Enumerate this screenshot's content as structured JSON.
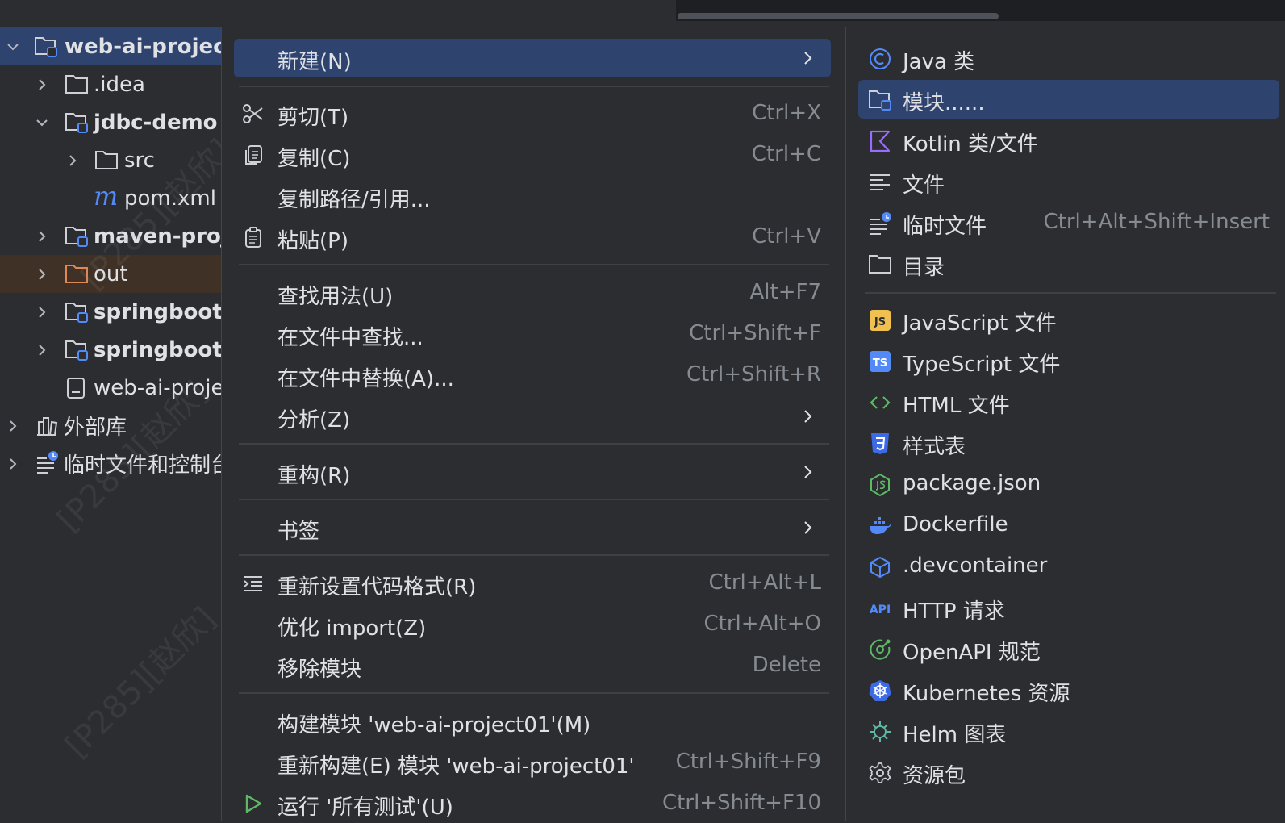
{
  "tree": {
    "items": [
      {
        "label": "web-ai-project",
        "icon": "module-folder-icon"
      },
      {
        "label": ".idea",
        "icon": "folder-icon"
      },
      {
        "label": "jdbc-demo",
        "icon": "module-folder-icon"
      },
      {
        "label": "src",
        "icon": "folder-icon"
      },
      {
        "label": "pom.xml",
        "icon": "maven-m-icon"
      },
      {
        "label": "maven-proj",
        "icon": "module-folder-icon"
      },
      {
        "label": "out",
        "icon": "excluded-folder-icon"
      },
      {
        "label": "springboot-",
        "icon": "module-folder-icon"
      },
      {
        "label": "springboot-",
        "icon": "module-folder-icon"
      },
      {
        "label": "web-ai-proje",
        "icon": "file-icon"
      },
      {
        "label": "外部库",
        "icon": "library-icon"
      },
      {
        "label": "临时文件和控制台",
        "icon": "scratch-icon"
      }
    ],
    "watermark": "[P285][赵欣]"
  },
  "menu": {
    "items": [
      {
        "label": "新建(N)",
        "shortcut": ""
      },
      {
        "label": "剪切(T)",
        "shortcut": "Ctrl+X"
      },
      {
        "label": "复制(C)",
        "shortcut": "Ctrl+C"
      },
      {
        "label": "复制路径/引用...",
        "shortcut": ""
      },
      {
        "label": "粘贴(P)",
        "shortcut": "Ctrl+V"
      },
      {
        "label": "查找用法(U)",
        "shortcut": "Alt+F7"
      },
      {
        "label": "在文件中查找...",
        "shortcut": "Ctrl+Shift+F"
      },
      {
        "label": "在文件中替换(A)...",
        "shortcut": "Ctrl+Shift+R"
      },
      {
        "label": "分析(Z)",
        "shortcut": ""
      },
      {
        "label": "重构(R)",
        "shortcut": ""
      },
      {
        "label": "书签",
        "shortcut": ""
      },
      {
        "label": "重新设置代码格式(R)",
        "shortcut": "Ctrl+Alt+L"
      },
      {
        "label": "优化 import(Z)",
        "shortcut": "Ctrl+Alt+O"
      },
      {
        "label": "移除模块",
        "shortcut": "Delete"
      },
      {
        "label": "构建模块 'web-ai-project01'(M)",
        "shortcut": ""
      },
      {
        "label": "重新构建(E) 模块 'web-ai-project01'",
        "shortcut": "Ctrl+Shift+F9"
      },
      {
        "label": "运行 '所有测试'(U)",
        "shortcut": "Ctrl+Shift+F10"
      }
    ]
  },
  "submenu": {
    "items": [
      {
        "label": "Java 类",
        "shortcut": ""
      },
      {
        "label": "模块......",
        "shortcut": ""
      },
      {
        "label": "Kotlin 类/文件",
        "shortcut": ""
      },
      {
        "label": "文件",
        "shortcut": ""
      },
      {
        "label": "临时文件",
        "shortcut": "Ctrl+Alt+Shift+Insert"
      },
      {
        "label": "目录",
        "shortcut": ""
      },
      {
        "label": "JavaScript 文件",
        "shortcut": ""
      },
      {
        "label": "TypeScript 文件",
        "shortcut": ""
      },
      {
        "label": "HTML 文件",
        "shortcut": ""
      },
      {
        "label": "样式表",
        "shortcut": ""
      },
      {
        "label": "package.json",
        "shortcut": ""
      },
      {
        "label": "Dockerfile",
        "shortcut": ""
      },
      {
        "label": ".devcontainer",
        "shortcut": ""
      },
      {
        "label": "HTTP 请求",
        "shortcut": ""
      },
      {
        "label": "OpenAPI 规范",
        "shortcut": ""
      },
      {
        "label": "Kubernetes 资源",
        "shortcut": ""
      },
      {
        "label": "Helm 图表",
        "shortcut": ""
      },
      {
        "label": "资源包",
        "shortcut": ""
      }
    ],
    "icon_text": {
      "js": "JS",
      "ts": "TS",
      "api": "API"
    }
  },
  "colors": {
    "background": "#2b2d30",
    "highlight": "#2e436e",
    "text": "#dfe1e5",
    "shortcut": "#868a91",
    "module_badge": "#548af7",
    "excluded_folder": "#e08855",
    "kotlin": "#9b6bff",
    "run_green": "#5fb865"
  }
}
